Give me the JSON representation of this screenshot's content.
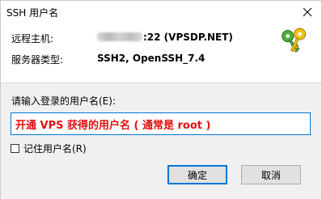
{
  "window": {
    "title": "SSH 用户名"
  },
  "info": {
    "host_label": "远程主机:",
    "host_value": ":22 (VPSDP.NET)",
    "server_type_label": "服务器类型:",
    "server_type_value": "SSH2, OpenSSH_7.4"
  },
  "form": {
    "prompt_label": "请输入登录的用户名(E):",
    "username_value": "开通 VPS 获得的用户名 ( 通常是 root )",
    "remember_label": "记住用户名(R)",
    "remember_checked": false
  },
  "buttons": {
    "ok_label": "确定",
    "cancel_label": "取消"
  },
  "icons": {
    "close": "close-icon",
    "keys": "keys-icon"
  },
  "colors": {
    "accent": "#0078d7",
    "input_text": "#e01010",
    "panel_bg": "#f0f0f0"
  }
}
